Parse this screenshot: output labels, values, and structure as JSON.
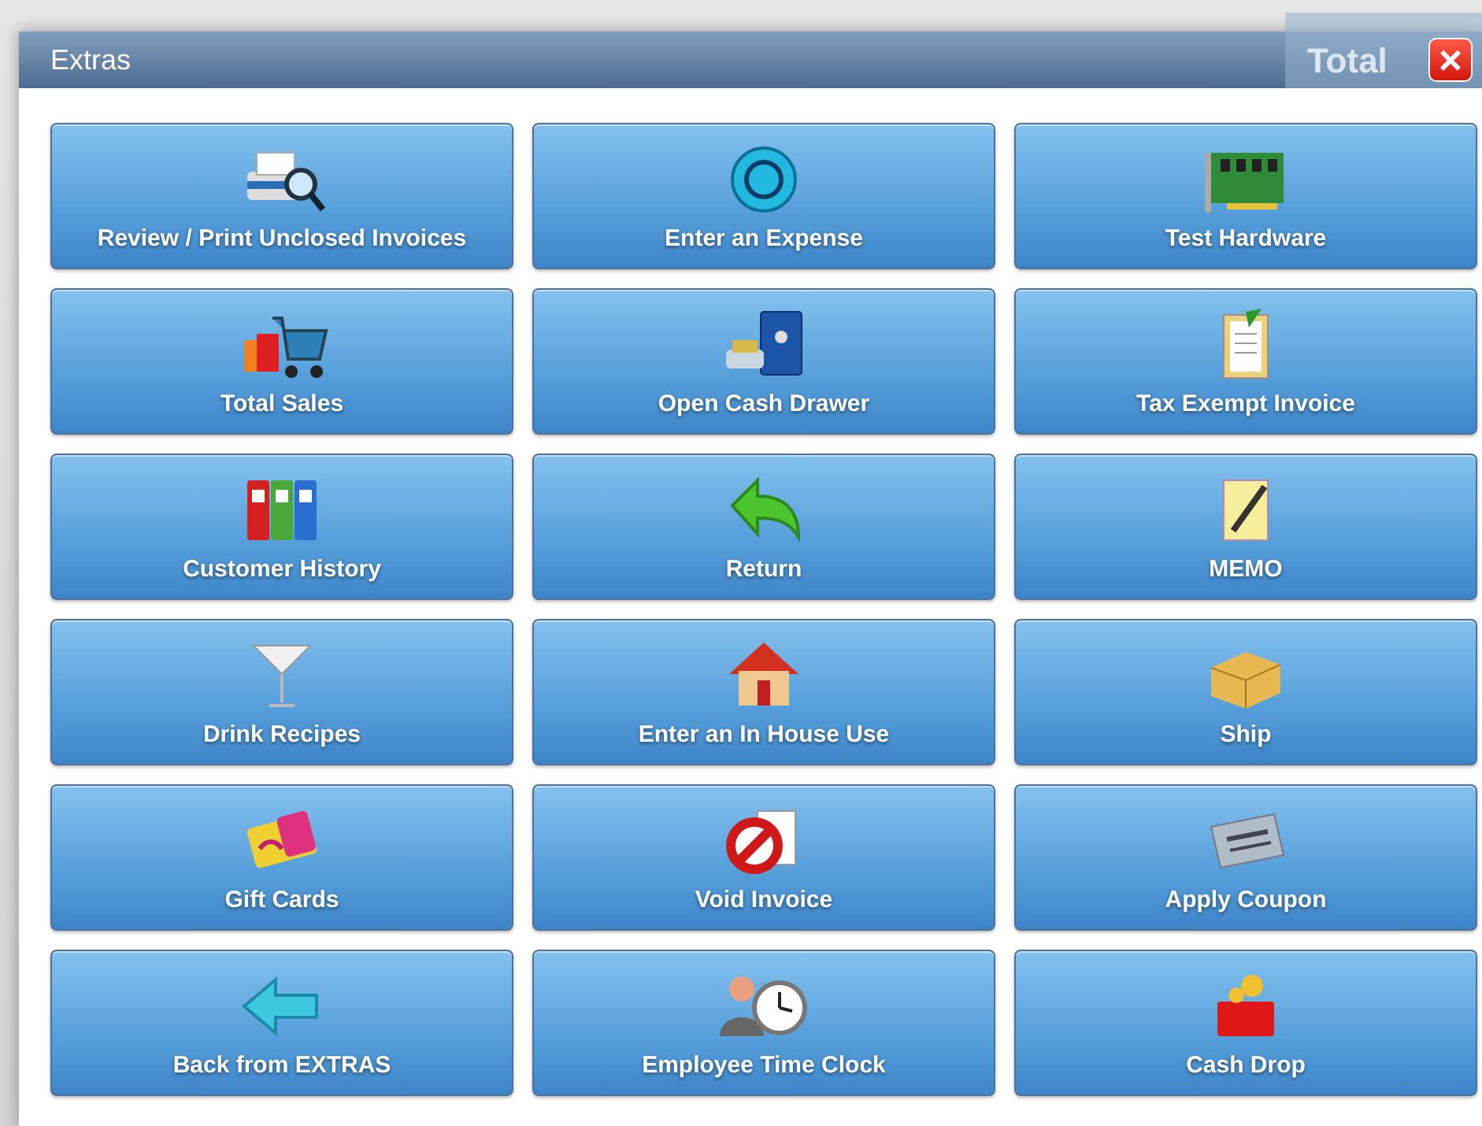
{
  "background": {
    "label": "Total"
  },
  "window": {
    "title": "Extras",
    "close": "×"
  },
  "buttons": [
    {
      "label": "Review / Print Unclosed Invoices"
    },
    {
      "label": "Enter an Expense"
    },
    {
      "label": "Test Hardware"
    },
    {
      "label": "Total Sales"
    },
    {
      "label": "Open Cash Drawer"
    },
    {
      "label": "Tax Exempt Invoice"
    },
    {
      "label": "Customer History"
    },
    {
      "label": "Return"
    },
    {
      "label": "MEMO"
    },
    {
      "label": "Drink Recipes"
    },
    {
      "label": "Enter an In House Use"
    },
    {
      "label": "Ship"
    },
    {
      "label": "Gift Cards"
    },
    {
      "label": "Void Invoice"
    },
    {
      "label": "Apply Coupon"
    },
    {
      "label": "Back from EXTRAS"
    },
    {
      "label": "Employee Time Clock"
    },
    {
      "label": "Cash Drop"
    }
  ]
}
